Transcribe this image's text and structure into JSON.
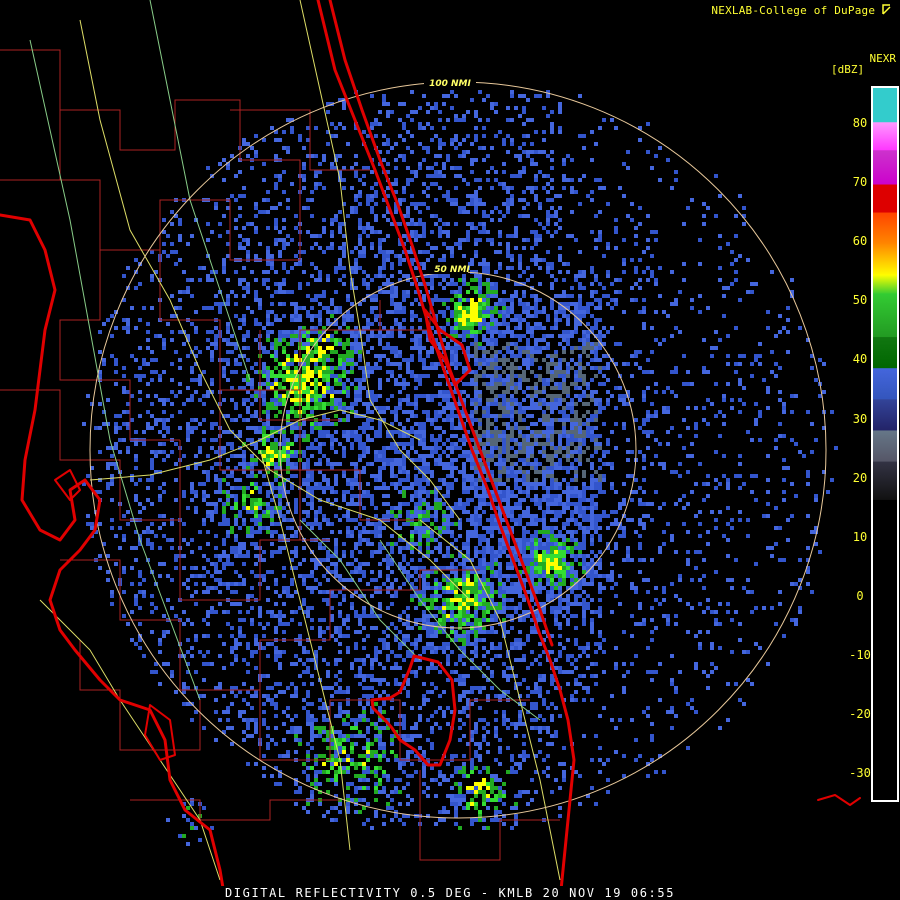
{
  "credit": "NEXLAB-College of DuPage",
  "credit_icon": "nexlab-logo-icon",
  "product": "NEXR",
  "unit": "[dBZ]",
  "ring_labels": {
    "outer": "100 NMI",
    "inner": "50 NMI"
  },
  "scale": {
    "ticks": [
      "80",
      "70",
      "60",
      "50",
      "40",
      "30",
      "20",
      "10",
      "0",
      "-10",
      "-20",
      "-30"
    ],
    "colors": {
      "cyan": "#33cccc",
      "magenta": "#ff33ff",
      "red": "#dd0000",
      "orange": "#ff8800",
      "yellow": "#ffff00",
      "green": "#33cc33",
      "darkgreen": "#006600",
      "blue": "#4466dd",
      "navy": "#222266",
      "gray": "#555566",
      "black": "#000000"
    }
  },
  "footer": "DIGITAL REFLECTIVITY 0.5 DEG - KMLB 20 NOV 19 06:55",
  "colors": {
    "coast": "#e00000",
    "county": "#aa2222",
    "road": "#dddd66",
    "road2": "#88cc88",
    "ring": "#e8c89a",
    "text": "#ffff33"
  }
}
